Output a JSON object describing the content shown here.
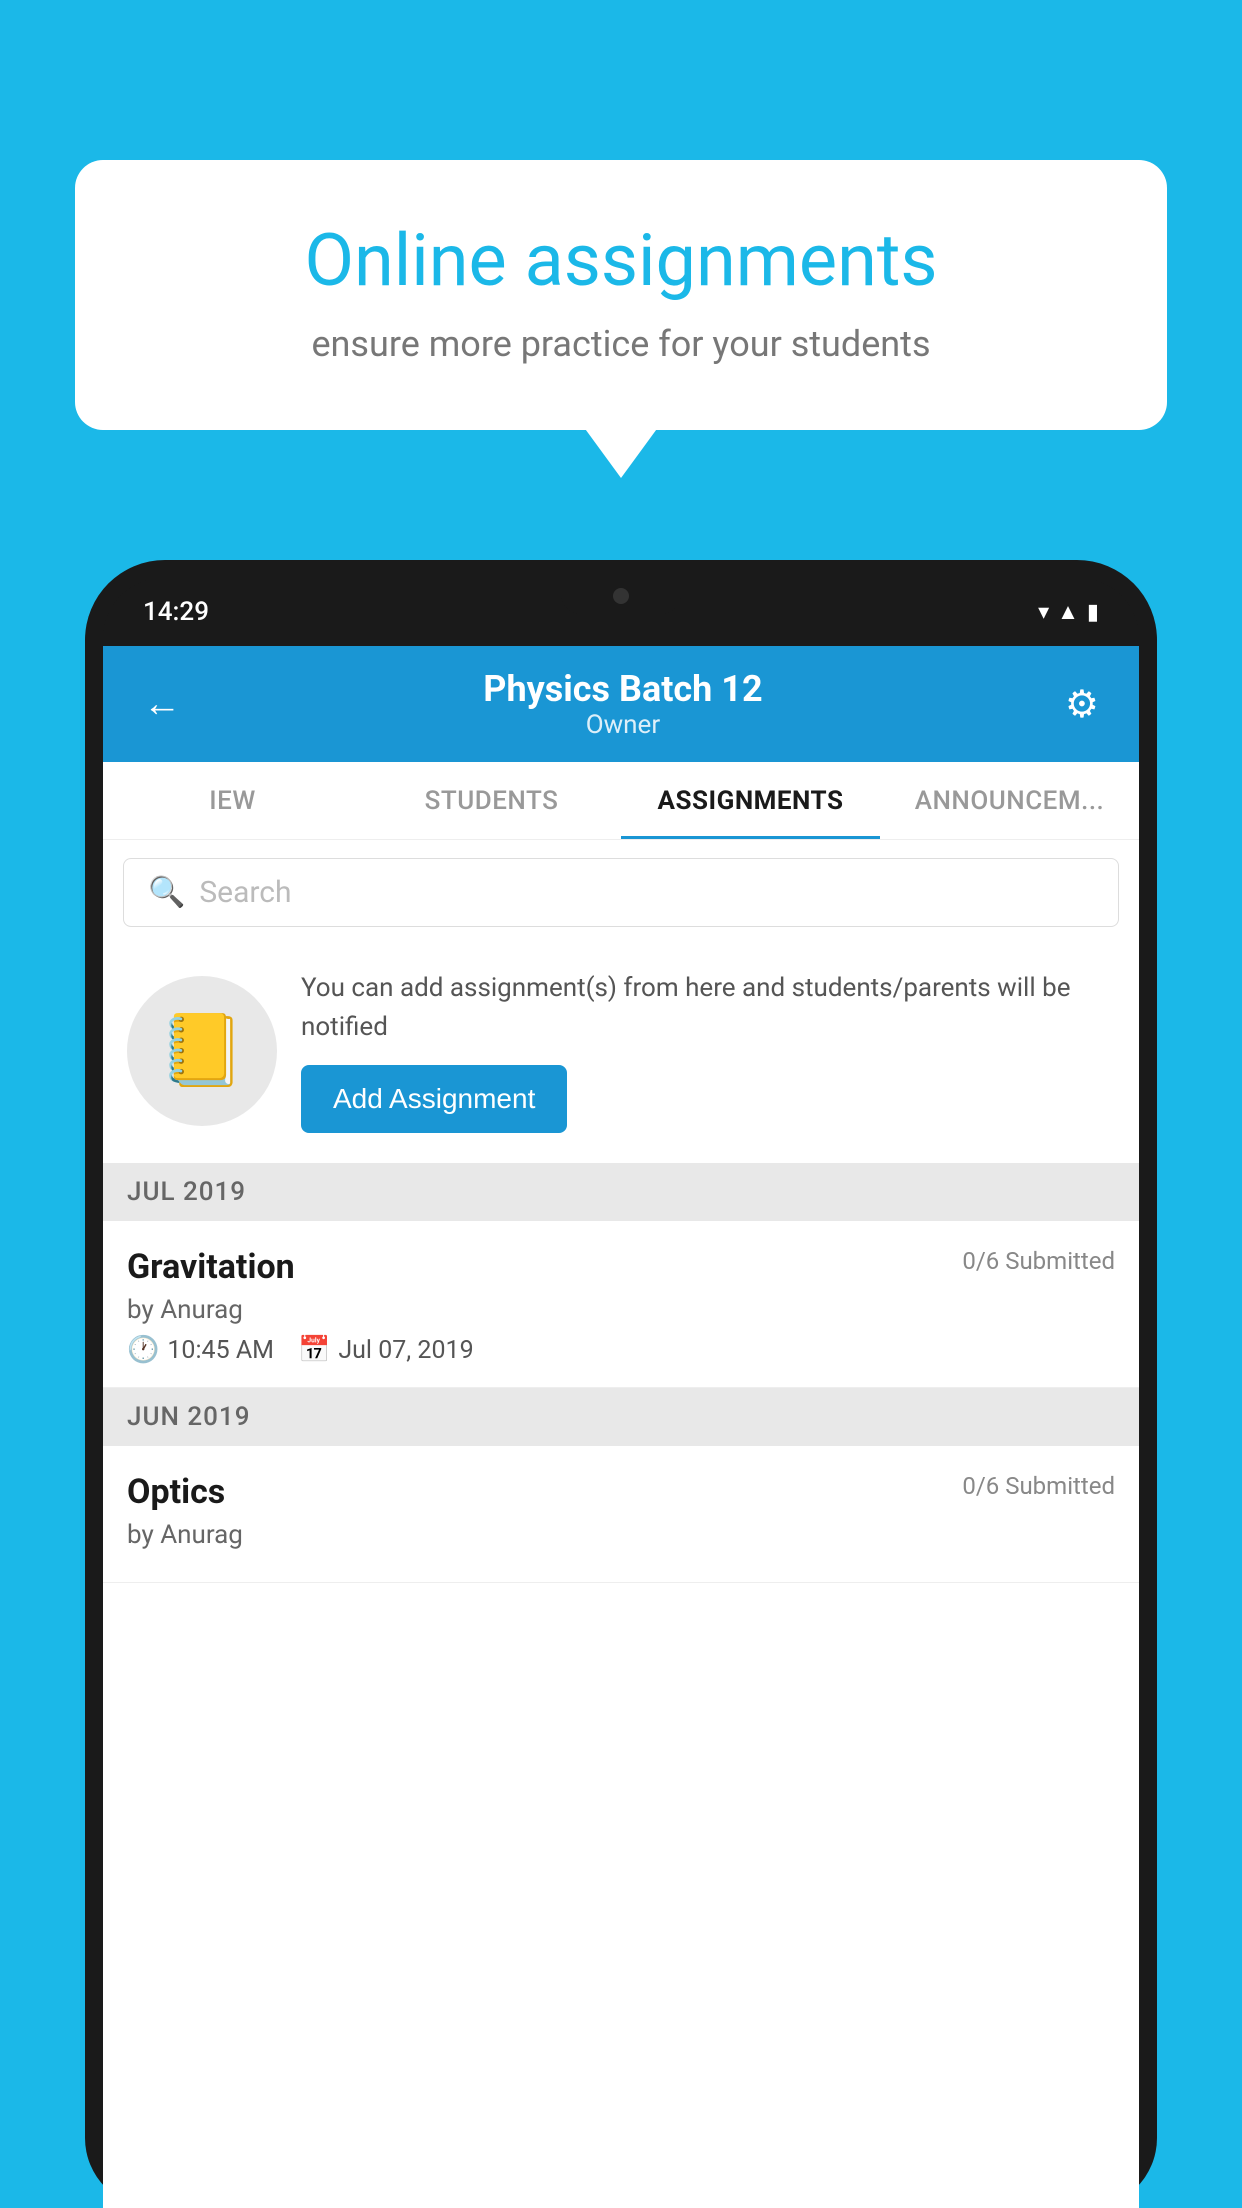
{
  "background_color": "#1bb8e8",
  "bubble": {
    "title": "Online assignments",
    "subtitle": "ensure more practice for your students"
  },
  "phone": {
    "status_bar": {
      "time": "14:29"
    },
    "header": {
      "title": "Physics Batch 12",
      "subtitle": "Owner",
      "back_label": "←",
      "settings_label": "⚙"
    },
    "tabs": [
      {
        "label": "IEW",
        "active": false
      },
      {
        "label": "STUDENTS",
        "active": false
      },
      {
        "label": "ASSIGNMENTS",
        "active": true
      },
      {
        "label": "ANNOUNCEM...",
        "active": false
      }
    ],
    "search": {
      "placeholder": "Search"
    },
    "promo": {
      "icon": "📒",
      "text": "You can add assignment(s) from here and students/parents will be notified",
      "button_label": "Add Assignment"
    },
    "sections": [
      {
        "label": "JUL 2019",
        "assignments": [
          {
            "name": "Gravitation",
            "submitted": "0/6 Submitted",
            "by": "by Anurag",
            "time": "10:45 AM",
            "date": "Jul 07, 2019"
          }
        ]
      },
      {
        "label": "JUN 2019",
        "assignments": [
          {
            "name": "Optics",
            "submitted": "0/6 Submitted",
            "by": "by Anurag",
            "time": "",
            "date": ""
          }
        ]
      }
    ]
  }
}
